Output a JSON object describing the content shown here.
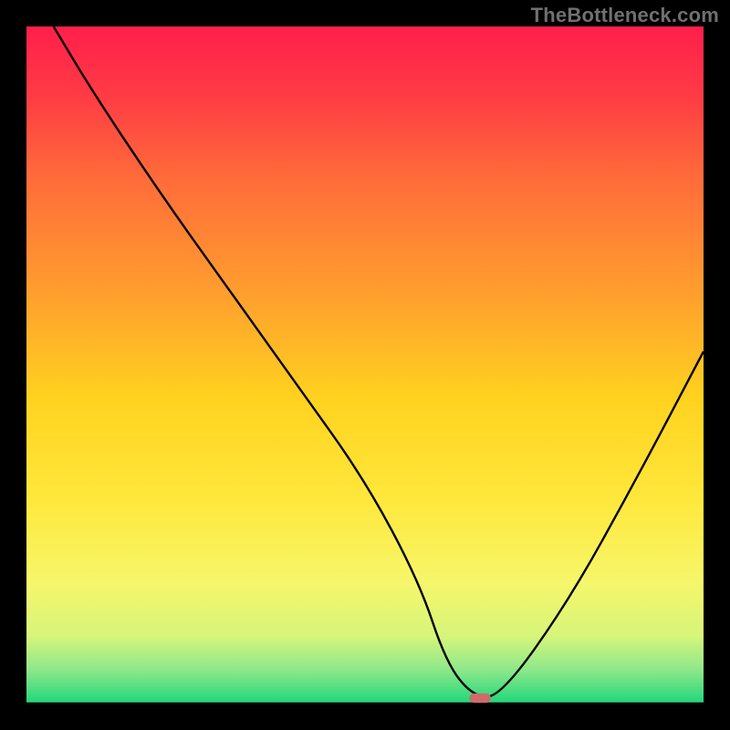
{
  "watermark": {
    "text": "TheBottleneck.com"
  },
  "chart_data": {
    "type": "line",
    "title": "",
    "xlabel": "",
    "ylabel": "",
    "xlim": [
      0,
      100
    ],
    "ylim": [
      0,
      100
    ],
    "x": [
      4,
      10,
      20,
      30,
      40,
      50,
      58,
      62,
      66,
      70,
      80,
      90,
      100
    ],
    "values": [
      100,
      90,
      75,
      61,
      47,
      33,
      18,
      6,
      1,
      1,
      15,
      33,
      52
    ],
    "marker": {
      "x": 67,
      "y": 0.8,
      "color": "#cf6b6b",
      "width_pct": 3.2,
      "height_pct": 1.4
    },
    "axis_y": 0,
    "gradient_stops": [
      {
        "offset": 0.0,
        "color": "#ff1f4b"
      },
      {
        "offset": 0.1,
        "color": "#ff3a45"
      },
      {
        "offset": 0.22,
        "color": "#ff6a3a"
      },
      {
        "offset": 0.38,
        "color": "#ff9a2f"
      },
      {
        "offset": 0.55,
        "color": "#ffd21f"
      },
      {
        "offset": 0.7,
        "color": "#ffe83c"
      },
      {
        "offset": 0.82,
        "color": "#f6f66a"
      },
      {
        "offset": 0.9,
        "color": "#d7f57a"
      },
      {
        "offset": 0.95,
        "color": "#8ee88a"
      },
      {
        "offset": 1.0,
        "color": "#1fd67a"
      }
    ]
  }
}
